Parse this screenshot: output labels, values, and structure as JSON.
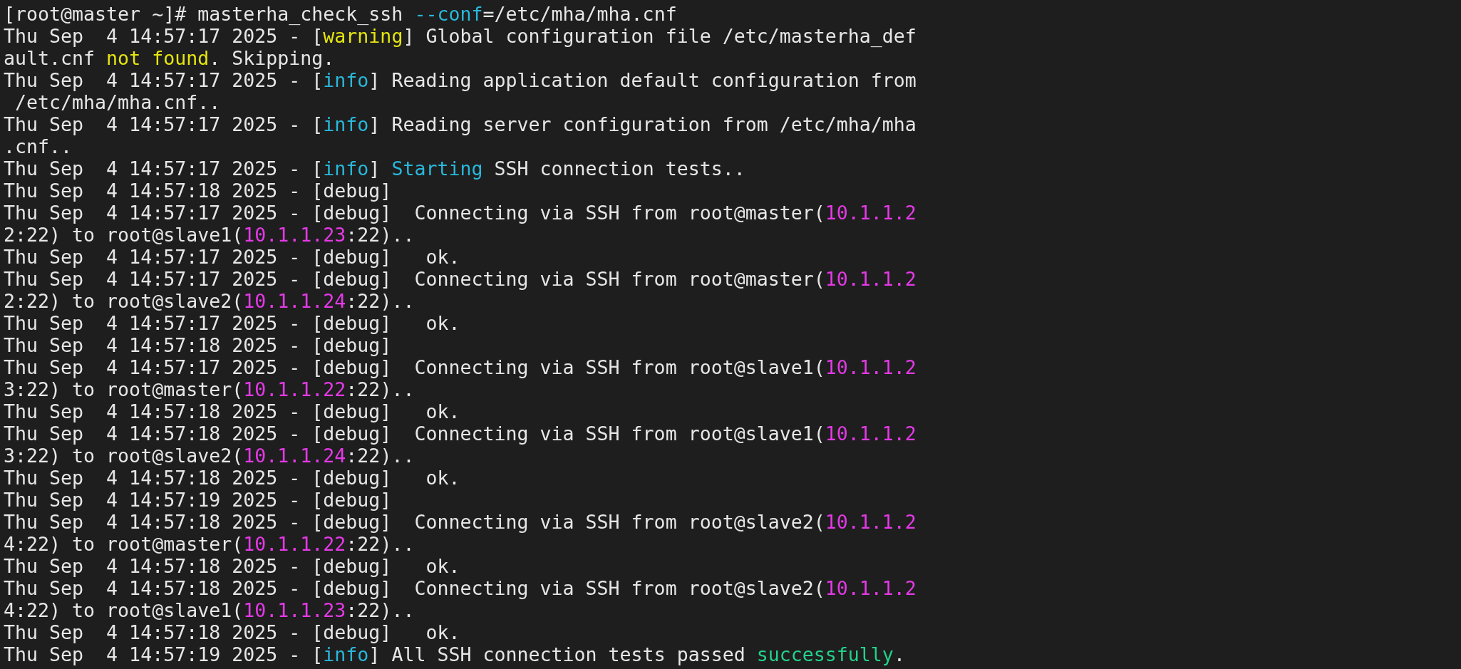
{
  "terminal": {
    "lines": [
      {
        "segments": [
          {
            "text": "[root@master ~]# masterha_check_ssh ",
            "kind": "plain"
          },
          {
            "text": "--conf",
            "kind": "flag"
          },
          {
            "text": "=/etc/mha/mha.cnf",
            "kind": "plain"
          }
        ]
      },
      {
        "segments": [
          {
            "text": "Thu Sep  4 14:57:17 2025 - [",
            "kind": "plain"
          },
          {
            "text": "warning",
            "kind": "warn"
          },
          {
            "text": "] Global configuration file /etc/masterha_def",
            "kind": "plain"
          }
        ]
      },
      {
        "segments": [
          {
            "text": "ault.cnf ",
            "kind": "plain"
          },
          {
            "text": "not found",
            "kind": "warn"
          },
          {
            "text": ". Skipping.",
            "kind": "plain"
          }
        ]
      },
      {
        "segments": [
          {
            "text": "Thu Sep  4 14:57:17 2025 - [",
            "kind": "plain"
          },
          {
            "text": "info",
            "kind": "info"
          },
          {
            "text": "] Reading application default configuration from",
            "kind": "plain"
          }
        ]
      },
      {
        "segments": [
          {
            "text": " /etc/mha/mha.cnf..",
            "kind": "plain"
          }
        ]
      },
      {
        "segments": [
          {
            "text": "Thu Sep  4 14:57:17 2025 - [",
            "kind": "plain"
          },
          {
            "text": "info",
            "kind": "info"
          },
          {
            "text": "] Reading server configuration from /etc/mha/mha",
            "kind": "plain"
          }
        ]
      },
      {
        "segments": [
          {
            "text": ".cnf..",
            "kind": "plain"
          }
        ]
      },
      {
        "segments": [
          {
            "text": "Thu Sep  4 14:57:17 2025 - [",
            "kind": "plain"
          },
          {
            "text": "info",
            "kind": "info"
          },
          {
            "text": "] ",
            "kind": "plain"
          },
          {
            "text": "Starting",
            "kind": "info"
          },
          {
            "text": " SSH connection tests..",
            "kind": "plain"
          }
        ]
      },
      {
        "segments": [
          {
            "text": "Thu Sep  4 14:57:18 2025 - [debug]",
            "kind": "plain"
          }
        ]
      },
      {
        "segments": [
          {
            "text": "Thu Sep  4 14:57:17 2025 - [debug]  Connecting via SSH from root@master(",
            "kind": "plain"
          },
          {
            "text": "10.1.1.2",
            "kind": "ip"
          }
        ]
      },
      {
        "segments": [
          {
            "text": "2:22) to root@slave1(",
            "kind": "plain"
          },
          {
            "text": "10.1.1.23",
            "kind": "ip"
          },
          {
            "text": ":22)..",
            "kind": "plain"
          }
        ]
      },
      {
        "segments": [
          {
            "text": "Thu Sep  4 14:57:17 2025 - [debug]   ok.",
            "kind": "plain"
          }
        ]
      },
      {
        "segments": [
          {
            "text": "Thu Sep  4 14:57:17 2025 - [debug]  Connecting via SSH from root@master(",
            "kind": "plain"
          },
          {
            "text": "10.1.1.2",
            "kind": "ip"
          }
        ]
      },
      {
        "segments": [
          {
            "text": "2:22) to root@slave2(",
            "kind": "plain"
          },
          {
            "text": "10.1.1.24",
            "kind": "ip"
          },
          {
            "text": ":22)..",
            "kind": "plain"
          }
        ]
      },
      {
        "segments": [
          {
            "text": "Thu Sep  4 14:57:17 2025 - [debug]   ok.",
            "kind": "plain"
          }
        ]
      },
      {
        "segments": [
          {
            "text": "Thu Sep  4 14:57:18 2025 - [debug]",
            "kind": "plain"
          }
        ]
      },
      {
        "segments": [
          {
            "text": "Thu Sep  4 14:57:17 2025 - [debug]  Connecting via SSH from root@slave1(",
            "kind": "plain"
          },
          {
            "text": "10.1.1.2",
            "kind": "ip"
          }
        ]
      },
      {
        "segments": [
          {
            "text": "3:22) to root@master(",
            "kind": "plain"
          },
          {
            "text": "10.1.1.22",
            "kind": "ip"
          },
          {
            "text": ":22)..",
            "kind": "plain"
          }
        ]
      },
      {
        "segments": [
          {
            "text": "Thu Sep  4 14:57:18 2025 - [debug]   ok.",
            "kind": "plain"
          }
        ]
      },
      {
        "segments": [
          {
            "text": "Thu Sep  4 14:57:18 2025 - [debug]  Connecting via SSH from root@slave1(",
            "kind": "plain"
          },
          {
            "text": "10.1.1.2",
            "kind": "ip"
          }
        ]
      },
      {
        "segments": [
          {
            "text": "3:22) to root@slave2(",
            "kind": "plain"
          },
          {
            "text": "10.1.1.24",
            "kind": "ip"
          },
          {
            "text": ":22)..",
            "kind": "plain"
          }
        ]
      },
      {
        "segments": [
          {
            "text": "Thu Sep  4 14:57:18 2025 - [debug]   ok.",
            "kind": "plain"
          }
        ]
      },
      {
        "segments": [
          {
            "text": "Thu Sep  4 14:57:19 2025 - [debug]",
            "kind": "plain"
          }
        ]
      },
      {
        "segments": [
          {
            "text": "Thu Sep  4 14:57:18 2025 - [debug]  Connecting via SSH from root@slave2(",
            "kind": "plain"
          },
          {
            "text": "10.1.1.2",
            "kind": "ip"
          }
        ]
      },
      {
        "segments": [
          {
            "text": "4:22) to root@master(",
            "kind": "plain"
          },
          {
            "text": "10.1.1.22",
            "kind": "ip"
          },
          {
            "text": ":22)..",
            "kind": "plain"
          }
        ]
      },
      {
        "segments": [
          {
            "text": "Thu Sep  4 14:57:18 2025 - [debug]   ok.",
            "kind": "plain"
          }
        ]
      },
      {
        "segments": [
          {
            "text": "Thu Sep  4 14:57:18 2025 - [debug]  Connecting via SSH from root@slave2(",
            "kind": "plain"
          },
          {
            "text": "10.1.1.2",
            "kind": "ip"
          }
        ]
      },
      {
        "segments": [
          {
            "text": "4:22) to root@slave1(",
            "kind": "plain"
          },
          {
            "text": "10.1.1.23",
            "kind": "ip"
          },
          {
            "text": ":22)..",
            "kind": "plain"
          }
        ]
      },
      {
        "segments": [
          {
            "text": "Thu Sep  4 14:57:18 2025 - [debug]   ok.",
            "kind": "plain"
          }
        ]
      },
      {
        "segments": [
          {
            "text": "Thu Sep  4 14:57:19 2025 - [",
            "kind": "plain"
          },
          {
            "text": "info",
            "kind": "info"
          },
          {
            "text": "] All SSH connection tests passed ",
            "kind": "plain"
          },
          {
            "text": "successfully",
            "kind": "ok"
          },
          {
            "text": ".",
            "kind": "plain"
          }
        ]
      }
    ]
  }
}
